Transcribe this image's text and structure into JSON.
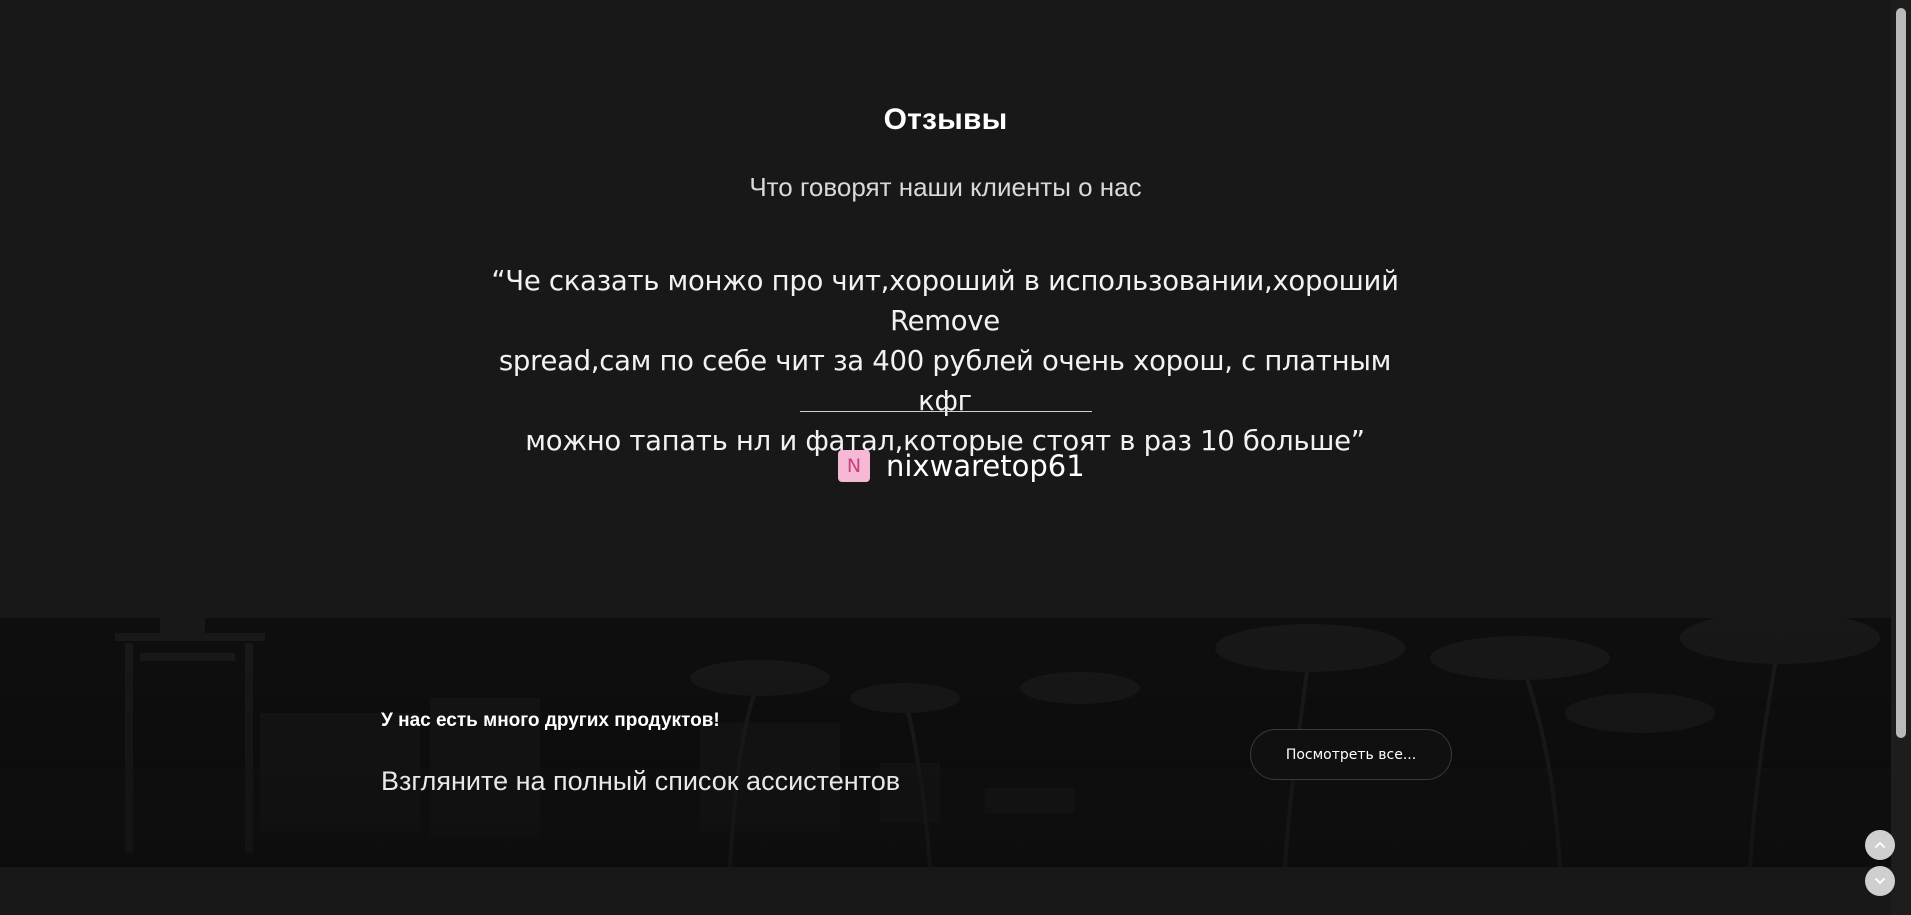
{
  "reviews": {
    "title": "Отзывы",
    "subtitle": "Что говорят наши клиенты о нас",
    "quote_lines": [
      "“Че сказать монжо про чит,хороший в использовании,хороший Remove",
      "spread,сам по себе чит за 400 рублей очень хорош, с платным кфг",
      "можно тапать нл и фатал,которые стоят в раз 10 больше”"
    ],
    "author": {
      "avatar_letter": "N",
      "name": "nixwaretop61",
      "avatar_bg": "#f6b8d4",
      "avatar_fg": "#c93f7d"
    }
  },
  "banner": {
    "heading": "У нас есть много других продуктов!",
    "text": "Взгляните на полный список ассистентов",
    "button_label": "Посмотреть все..."
  },
  "controls": {
    "scroll_up_icon": "chevron-up-icon",
    "scroll_down_icon": "chevron-down-icon"
  },
  "colors": {
    "background": "#171717",
    "banner_background": "#0f0f0f",
    "text": "#ffffff"
  }
}
